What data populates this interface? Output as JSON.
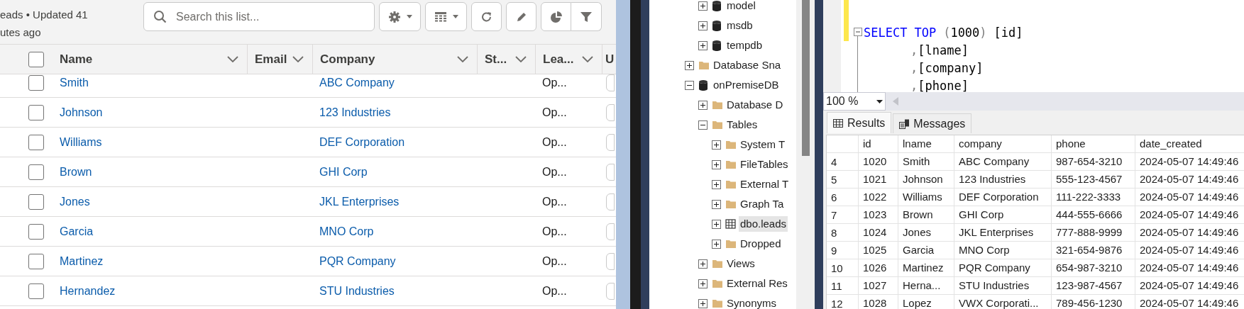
{
  "list_view": {
    "subtitle_lines": [
      "eads • Updated 41",
      "utes ago"
    ],
    "search": {
      "placeholder": "Search this list..."
    },
    "toolbar": [
      {
        "kind": "settings",
        "caret": true
      },
      {
        "kind": "table",
        "caret": true
      },
      {
        "kind": "refresh",
        "caret": false
      },
      {
        "kind": "edit",
        "caret": false
      },
      {
        "kind": "chart",
        "caret": false
      },
      {
        "kind": "filter",
        "caret": false
      }
    ],
    "select_all": {
      "checked": false
    },
    "columns": [
      {
        "label": "Name"
      },
      {
        "label": "Email"
      },
      {
        "label": "Company"
      },
      {
        "label": "St..."
      },
      {
        "label": "Lea..."
      },
      {
        "label": "U"
      }
    ],
    "rows": [
      {
        "name": "Smith",
        "company": "ABC Company",
        "status": "Op...",
        "checked": false
      },
      {
        "name": "Johnson",
        "company": "123 Industries",
        "status": "Op...",
        "checked": false
      },
      {
        "name": "Williams",
        "company": "DEF Corporation",
        "status": "Op...",
        "checked": false
      },
      {
        "name": "Brown",
        "company": "GHI Corp",
        "status": "Op...",
        "checked": false
      },
      {
        "name": "Jones",
        "company": "JKL Enterprises",
        "status": "Op...",
        "checked": false
      },
      {
        "name": "Garcia",
        "company": "MNO Corp",
        "status": "Op...",
        "checked": false
      },
      {
        "name": "Martinez",
        "company": "PQR Company",
        "status": "Op...",
        "checked": false
      },
      {
        "name": "Hernandez",
        "company": "STU Industries",
        "status": "Op...",
        "checked": false
      }
    ]
  },
  "object_explorer": [
    {
      "children": [
        {
          "label": "model",
          "kind": "database",
          "expanded": false
        },
        {
          "label": "msdb",
          "kind": "database",
          "expanded": false
        },
        {
          "label": "tempdb",
          "kind": "database",
          "expanded": false
        }
      ]
    },
    {
      "label": "Database Sna",
      "kind": "folder",
      "expanded": false
    },
    {
      "label": "onPremiseDB",
      "kind": "database",
      "expanded": true,
      "children": [
        {
          "label": "Database D",
          "kind": "folder",
          "expanded": false
        },
        {
          "label": "Tables",
          "kind": "folder",
          "expanded": true,
          "children": [
            {
              "label": "System T",
              "kind": "folder",
              "expanded": false
            },
            {
              "label": "FileTables",
              "kind": "folder",
              "expanded": false
            },
            {
              "label": "External T",
              "kind": "folder",
              "expanded": false
            },
            {
              "label": "Graph Ta",
              "kind": "folder",
              "expanded": false
            },
            {
              "label": "dbo.leads",
              "kind": "table",
              "expanded": false,
              "selected": true
            },
            {
              "label": "Dropped",
              "kind": "folder",
              "expanded": false
            }
          ]
        },
        {
          "label": "Views",
          "kind": "folder",
          "expanded": false
        },
        {
          "label": "External Res",
          "kind": "folder",
          "expanded": false
        },
        {
          "label": "Synonyms",
          "kind": "folder",
          "expanded": false
        }
      ]
    }
  ],
  "query_editor": {
    "lines": [
      {
        "indent": false,
        "tokens": [
          {
            "kind": "keyword",
            "text": "SELECT"
          },
          {
            "kind": "keyword",
            "text": "TOP"
          },
          {
            "kind": "punct",
            "text": "("
          },
          {
            "kind": "text",
            "text": "1000"
          },
          {
            "kind": "punct",
            "text": ")"
          },
          {
            "kind": "text",
            "text": "[id]"
          }
        ]
      },
      {
        "indent": true,
        "tokens": [
          {
            "kind": "punct",
            "text": ","
          },
          {
            "kind": "text",
            "text": "[lname]"
          }
        ]
      },
      {
        "indent": true,
        "tokens": [
          {
            "kind": "punct",
            "text": ","
          },
          {
            "kind": "text",
            "text": "[company]"
          }
        ]
      },
      {
        "indent": true,
        "tokens": [
          {
            "kind": "punct",
            "text": ","
          },
          {
            "kind": "text",
            "text": "[phone]"
          }
        ]
      }
    ]
  },
  "zoom": "100 %",
  "result_tabs": [
    {
      "label": "Results",
      "kind": "grid",
      "selected": true
    },
    {
      "label": "Messages",
      "kind": "messages",
      "selected": false
    }
  ],
  "results": {
    "columns": [
      "id",
      "lname",
      "company",
      "phone",
      "date_created"
    ],
    "rows": [
      {
        "row": "4",
        "cells": [
          "1020",
          "Smith",
          "ABC Company",
          "987-654-3210",
          "2024-05-07 14:49:46"
        ]
      },
      {
        "row": "5",
        "cells": [
          "1021",
          "Johnson",
          "123 Industries",
          "555-123-4567",
          "2024-05-07 14:49:46"
        ]
      },
      {
        "row": "6",
        "cells": [
          "1022",
          "Williams",
          "DEF Corporation",
          "111-222-3333",
          "2024-05-07 14:49:46"
        ]
      },
      {
        "row": "7",
        "cells": [
          "1023",
          "Brown",
          "GHI Corp",
          "444-555-6666",
          "2024-05-07 14:49:46"
        ]
      },
      {
        "row": "8",
        "cells": [
          "1024",
          "Jones",
          "JKL Enterprises",
          "777-888-9999",
          "2024-05-07 14:49:46"
        ]
      },
      {
        "row": "9",
        "cells": [
          "1025",
          "Garcia",
          "MNO Corp",
          "321-654-9876",
          "2024-05-07 14:49:46"
        ]
      },
      {
        "row": "10",
        "cells": [
          "1026",
          "Martinez",
          "PQR Company",
          "654-987-3210",
          "2024-05-07 14:49:46"
        ]
      },
      {
        "row": "11",
        "cells": [
          "1027",
          "Herna...",
          "STU Industries",
          "123-987-4567",
          "2024-05-07 14:49:46"
        ]
      },
      {
        "row": "12",
        "cells": [
          "1028",
          "Lopez",
          "VWX Corporati...",
          "789-456-1230",
          "2024-05-07 14:49:46"
        ]
      }
    ]
  }
}
